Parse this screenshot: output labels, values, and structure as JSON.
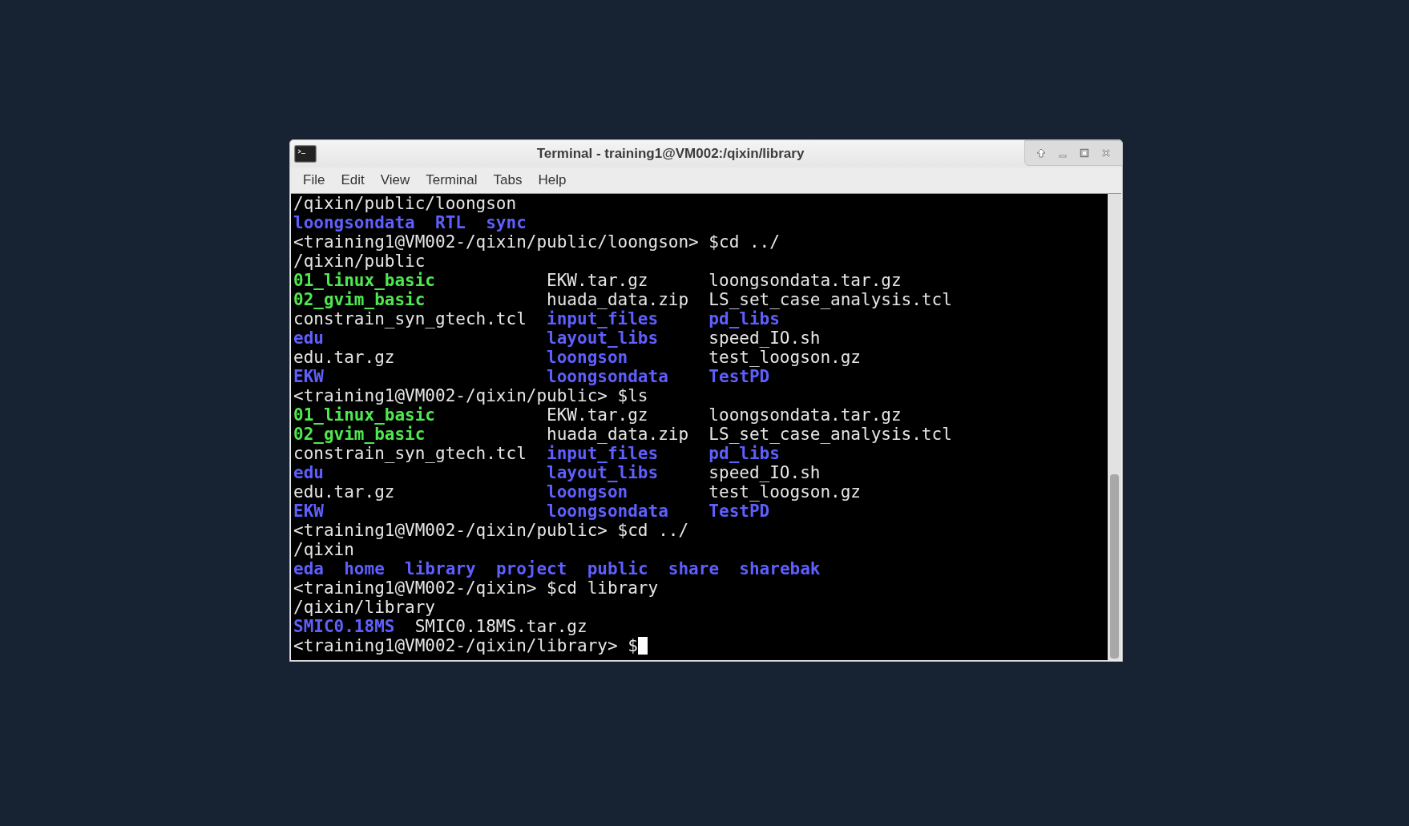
{
  "window": {
    "title": "Terminal - training1@VM002:/qixin/library"
  },
  "menu": [
    "File",
    "Edit",
    "View",
    "Terminal",
    "Tabs",
    "Help"
  ],
  "terminal": {
    "lines": [
      {
        "kind": "text",
        "text": "/qixin/public/loongson"
      },
      {
        "kind": "row",
        "cells": [
          {
            "text": "loongsondata",
            "kind": "dir"
          },
          {
            "text": "RTL",
            "kind": "dir"
          },
          {
            "text": "sync",
            "kind": "dir"
          }
        ]
      },
      {
        "kind": "prompt",
        "text": "<training1@VM002-/qixin/public/loongson> $cd ../",
        "cursor": false
      },
      {
        "kind": "text",
        "text": "/qixin/public"
      },
      {
        "kind": "grid",
        "cells": [
          {
            "text": "01_linux_basic",
            "kind": "exec"
          },
          {
            "text": "EKW.tar.gz",
            "kind": "file"
          },
          {
            "text": "loongsondata.tar.gz",
            "kind": "file"
          }
        ]
      },
      {
        "kind": "grid",
        "cells": [
          {
            "text": "02_gvim_basic",
            "kind": "exec"
          },
          {
            "text": "huada_data.zip",
            "kind": "file"
          },
          {
            "text": "LS_set_case_analysis.tcl",
            "kind": "file"
          }
        ]
      },
      {
        "kind": "grid",
        "cells": [
          {
            "text": "constrain_syn_gtech.tcl",
            "kind": "file"
          },
          {
            "text": "input_files",
            "kind": "dir"
          },
          {
            "text": "pd_libs",
            "kind": "dir"
          }
        ]
      },
      {
        "kind": "grid",
        "cells": [
          {
            "text": "edu",
            "kind": "dir"
          },
          {
            "text": "layout_libs",
            "kind": "dir"
          },
          {
            "text": "speed_IO.sh",
            "kind": "file"
          }
        ]
      },
      {
        "kind": "grid",
        "cells": [
          {
            "text": "edu.tar.gz",
            "kind": "file"
          },
          {
            "text": "loongson",
            "kind": "dir"
          },
          {
            "text": "test_loogson.gz",
            "kind": "file"
          }
        ]
      },
      {
        "kind": "grid",
        "cells": [
          {
            "text": "EKW",
            "kind": "dir"
          },
          {
            "text": "loongsondata",
            "kind": "dir"
          },
          {
            "text": "TestPD",
            "kind": "dir"
          }
        ]
      },
      {
        "kind": "prompt",
        "text": "<training1@VM002-/qixin/public> $ls",
        "cursor": false
      },
      {
        "kind": "grid",
        "cells": [
          {
            "text": "01_linux_basic",
            "kind": "exec"
          },
          {
            "text": "EKW.tar.gz",
            "kind": "file"
          },
          {
            "text": "loongsondata.tar.gz",
            "kind": "file"
          }
        ]
      },
      {
        "kind": "grid",
        "cells": [
          {
            "text": "02_gvim_basic",
            "kind": "exec"
          },
          {
            "text": "huada_data.zip",
            "kind": "file"
          },
          {
            "text": "LS_set_case_analysis.tcl",
            "kind": "file"
          }
        ]
      },
      {
        "kind": "grid",
        "cells": [
          {
            "text": "constrain_syn_gtech.tcl",
            "kind": "file"
          },
          {
            "text": "input_files",
            "kind": "dir"
          },
          {
            "text": "pd_libs",
            "kind": "dir"
          }
        ]
      },
      {
        "kind": "grid",
        "cells": [
          {
            "text": "edu",
            "kind": "dir"
          },
          {
            "text": "layout_libs",
            "kind": "dir"
          },
          {
            "text": "speed_IO.sh",
            "kind": "file"
          }
        ]
      },
      {
        "kind": "grid",
        "cells": [
          {
            "text": "edu.tar.gz",
            "kind": "file"
          },
          {
            "text": "loongson",
            "kind": "dir"
          },
          {
            "text": "test_loogson.gz",
            "kind": "file"
          }
        ]
      },
      {
        "kind": "grid",
        "cells": [
          {
            "text": "EKW",
            "kind": "dir"
          },
          {
            "text": "loongsondata",
            "kind": "dir"
          },
          {
            "text": "TestPD",
            "kind": "dir"
          }
        ]
      },
      {
        "kind": "prompt",
        "text": "<training1@VM002-/qixin/public> $cd ../",
        "cursor": false
      },
      {
        "kind": "text",
        "text": "/qixin"
      },
      {
        "kind": "row",
        "cells": [
          {
            "text": "eda",
            "kind": "dir"
          },
          {
            "text": "home",
            "kind": "dir"
          },
          {
            "text": "library",
            "kind": "dir"
          },
          {
            "text": "project",
            "kind": "dir"
          },
          {
            "text": "public",
            "kind": "dir"
          },
          {
            "text": "share",
            "kind": "dir"
          },
          {
            "text": "sharebak",
            "kind": "dir"
          }
        ]
      },
      {
        "kind": "prompt",
        "text": "<training1@VM002-/qixin> $cd library",
        "cursor": false
      },
      {
        "kind": "text",
        "text": "/qixin/library"
      },
      {
        "kind": "row",
        "cells": [
          {
            "text": "SMIC0.18MS",
            "kind": "dir"
          },
          {
            "text": "SMIC0.18MS.tar.gz",
            "kind": "file"
          }
        ]
      },
      {
        "kind": "prompt",
        "text": "<training1@VM002-/qixin/library> $",
        "cursor": true
      }
    ]
  }
}
